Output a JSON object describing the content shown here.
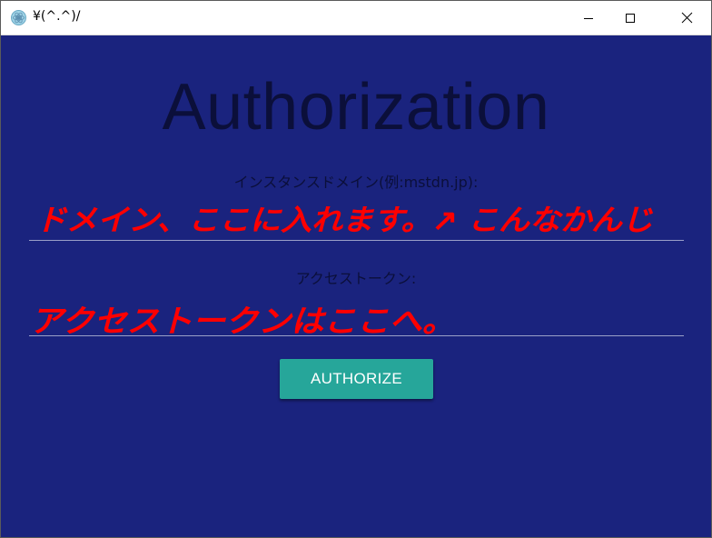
{
  "window": {
    "title": "¥(^.^)/"
  },
  "page": {
    "title": "Authorization"
  },
  "fields": {
    "domain": {
      "label": "インスタンスドメイン(例:mstdn.jp):",
      "annotation": "ドメイン、ここに入れます。↗ こんなかんじ"
    },
    "token": {
      "label": "アクセストークン:",
      "annotation": "アクセストークンはここへ。"
    }
  },
  "buttons": {
    "authorize": "AUTHORIZE"
  },
  "colors": {
    "background": "#1a237e",
    "accent": "#26a69a",
    "annotation": "#ff0000"
  },
  "icons": {
    "app": "app-icon",
    "minimize": "minimize-icon",
    "maximize": "maximize-icon",
    "close": "close-icon"
  }
}
